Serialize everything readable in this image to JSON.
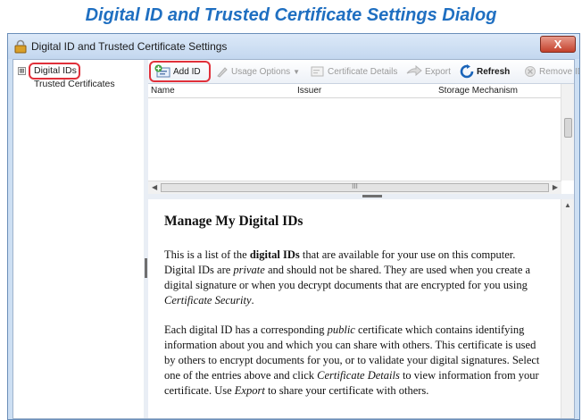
{
  "caption": "Digital ID and Trusted Certificate Settings Dialog",
  "window": {
    "title": "Digital ID and Trusted Certificate Settings",
    "close_label": "X"
  },
  "tree": {
    "expander": "⊞",
    "items": [
      "Digital IDs",
      "Trusted Certificates"
    ]
  },
  "toolbar": {
    "add_id": "Add ID",
    "usage_options": "Usage Options",
    "certificate_details": "Certificate Details",
    "export": "Export",
    "refresh": "Refresh",
    "remove_id": "Remove ID"
  },
  "grid": {
    "columns": [
      "Name",
      "Issuer",
      "Storage Mechanism"
    ],
    "hscroll_grip": "III"
  },
  "help": {
    "heading": "Manage My Digital IDs",
    "p1": {
      "t1": "This is a list of the ",
      "b1": "digital IDs",
      "t2": " that are available for your use on this computer. Digital IDs are ",
      "i1": "private",
      "t3": " and should not be shared. They are used when you create a digital signature or when you decrypt documents that are encrypted for you using ",
      "i2": "Certificate Security",
      "t4": "."
    },
    "p2": {
      "t1": "Each digital ID has a corresponding ",
      "i1": "public",
      "t2": " certificate which contains identifying information about you and which you can share with others. This certificate is used by others to encrypt documents for you, or to validate your digital signatures. Select one of the entries above and click ",
      "i2": "Certificate Details",
      "t3": " to view information from your certificate. Use ",
      "i3": "Export",
      "t4": " to share your certificate with others."
    }
  },
  "colors": {
    "caption": "#1f6fc1",
    "highlight": "#e0303a",
    "refresh_icon": "#1a64b8"
  }
}
